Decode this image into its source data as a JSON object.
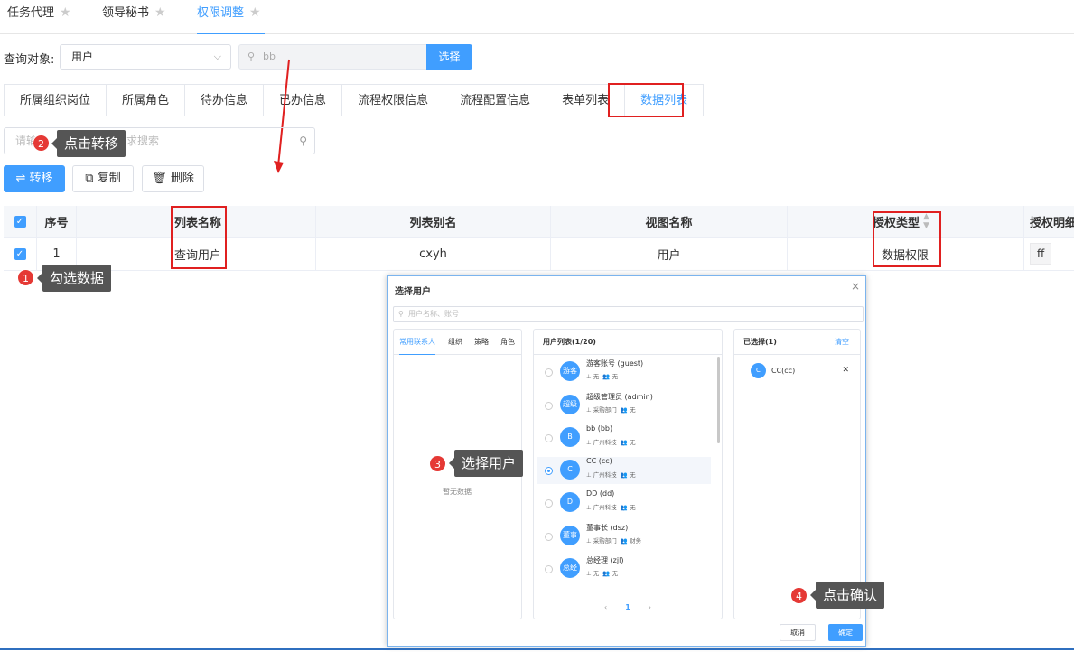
{
  "top_tabs": [
    {
      "label": "任务代理"
    },
    {
      "label": "领导秘书"
    },
    {
      "label": "权限调整"
    }
  ],
  "query": {
    "label": "查询对象:",
    "select_value": "用户",
    "input_value": "bb",
    "select_button": "选择"
  },
  "content_tabs": [
    "所属组织岗位",
    "所属角色",
    "待办信息",
    "已办信息",
    "流程权限信息",
    "流程配置信息",
    "表单列表",
    "数据列表"
  ],
  "search": {
    "placeholder_left": "请输",
    "placeholder_right": "求搜索"
  },
  "actions": {
    "transfer": "转移",
    "copy": "复制",
    "delete": "删除"
  },
  "table": {
    "headers": [
      "序号",
      "列表名称",
      "列表别名",
      "视图名称",
      "授权类型",
      "授权明细"
    ],
    "rows": [
      {
        "index": "1",
        "list_name": "查询用户",
        "alias": "cxyh",
        "view_name": "用户",
        "auth_type": "数据权限",
        "auth_detail": "ff"
      }
    ]
  },
  "callouts": [
    {
      "num": "1",
      "text": "勾选数据"
    },
    {
      "num": "2",
      "text": "点击转移"
    },
    {
      "num": "3",
      "text": "选择用户"
    },
    {
      "num": "4",
      "text": "点击确认"
    }
  ],
  "modal": {
    "title": "选择用户",
    "search_placeholder": "用户名称、账号",
    "left_tabs": [
      "常用联系人",
      "组织",
      "策略",
      "角色"
    ],
    "empty_text": "暂无数据",
    "list_title": "用户列表(1/20)",
    "users": [
      {
        "avatar": "游客",
        "name": "游客账号",
        "account": "(guest)",
        "org": "无",
        "group": "无"
      },
      {
        "avatar": "超级",
        "name": "超级管理员",
        "account": "(admin)",
        "org": "采购部门",
        "group": "无"
      },
      {
        "avatar": "B",
        "name": "bb",
        "account": "(bb)",
        "org": "广州科技",
        "group": "无"
      },
      {
        "avatar": "C",
        "name": "CC",
        "account": "(cc)",
        "org": "广州科技",
        "group": "无"
      },
      {
        "avatar": "D",
        "name": "DD",
        "account": "(dd)",
        "org": "广州科技",
        "group": "无"
      },
      {
        "avatar": "董事",
        "name": "董事长",
        "account": "(dsz)",
        "org": "采购部门",
        "group": "财务"
      },
      {
        "avatar": "总经",
        "name": "总经理",
        "account": "(zjl)",
        "org": "无",
        "group": "无"
      }
    ],
    "page": "1",
    "selected_title": "已选择(1)",
    "clear": "清空",
    "selected_user": {
      "avatar": "C",
      "name": "CC(cc)"
    },
    "cancel": "取消",
    "confirm": "确定"
  },
  "colors": {
    "accent": "#409eff",
    "highlight": "#e02020",
    "callout_bg": "#555555"
  }
}
